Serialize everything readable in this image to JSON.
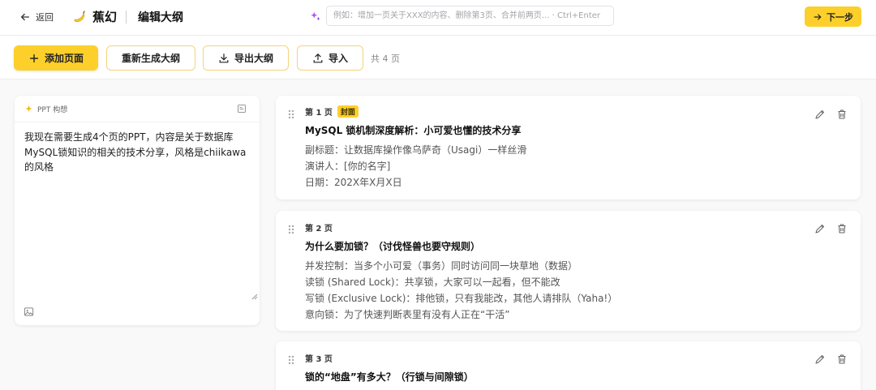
{
  "header": {
    "back_label": "返回",
    "brand": "蕉幻",
    "title": "编辑大纲",
    "ai_input_placeholder": "例如：增加一页关于XXX的内容、删除第3页、合并前两页... · Ctrl+Enter",
    "next_label": "下一步"
  },
  "toolbar": {
    "add_page_label": "添加页面",
    "regenerate_label": "重新生成大纲",
    "export_label": "导出大纲",
    "import_label": "导入",
    "page_count": "共 4 页"
  },
  "prompt_panel": {
    "heading": "PPT 构想",
    "text": "我现在需要生成4个页的PPT，内容是关于数据库MySQL锁知识的相关的技术分享，风格是chiikawa的风格"
  },
  "pages": [
    {
      "label": "第 1 页",
      "badge": "封面",
      "title": "MySQL 锁机制深度解析：小可爱也懂的技术分享",
      "lines": [
        "副标题：让数据库操作像乌萨奇（Usagi）一样丝滑",
        "演讲人：[你的名字]",
        "日期：202X年X月X日"
      ]
    },
    {
      "label": "第 2 页",
      "badge": "",
      "title": "为什么要加锁？（讨伐怪兽也要守规则）",
      "lines": [
        "并发控制：当多个小可爱（事务）同时访问同一块草地（数据）",
        "读锁 (Shared Lock)：共享锁，大家可以一起看，但不能改",
        "写锁 (Exclusive Lock)：排他锁，只有我能改，其他人请排队（Yaha!）",
        "意向锁：为了快速判断表里有没有人正在“干活”"
      ]
    },
    {
      "label": "第 3 页",
      "badge": "",
      "title": "锁的“地盘”有多大？（行锁与间隙锁）",
      "lines": []
    }
  ],
  "colors": {
    "accent": "#fdcf2a",
    "background": "#f9f9fa"
  }
}
